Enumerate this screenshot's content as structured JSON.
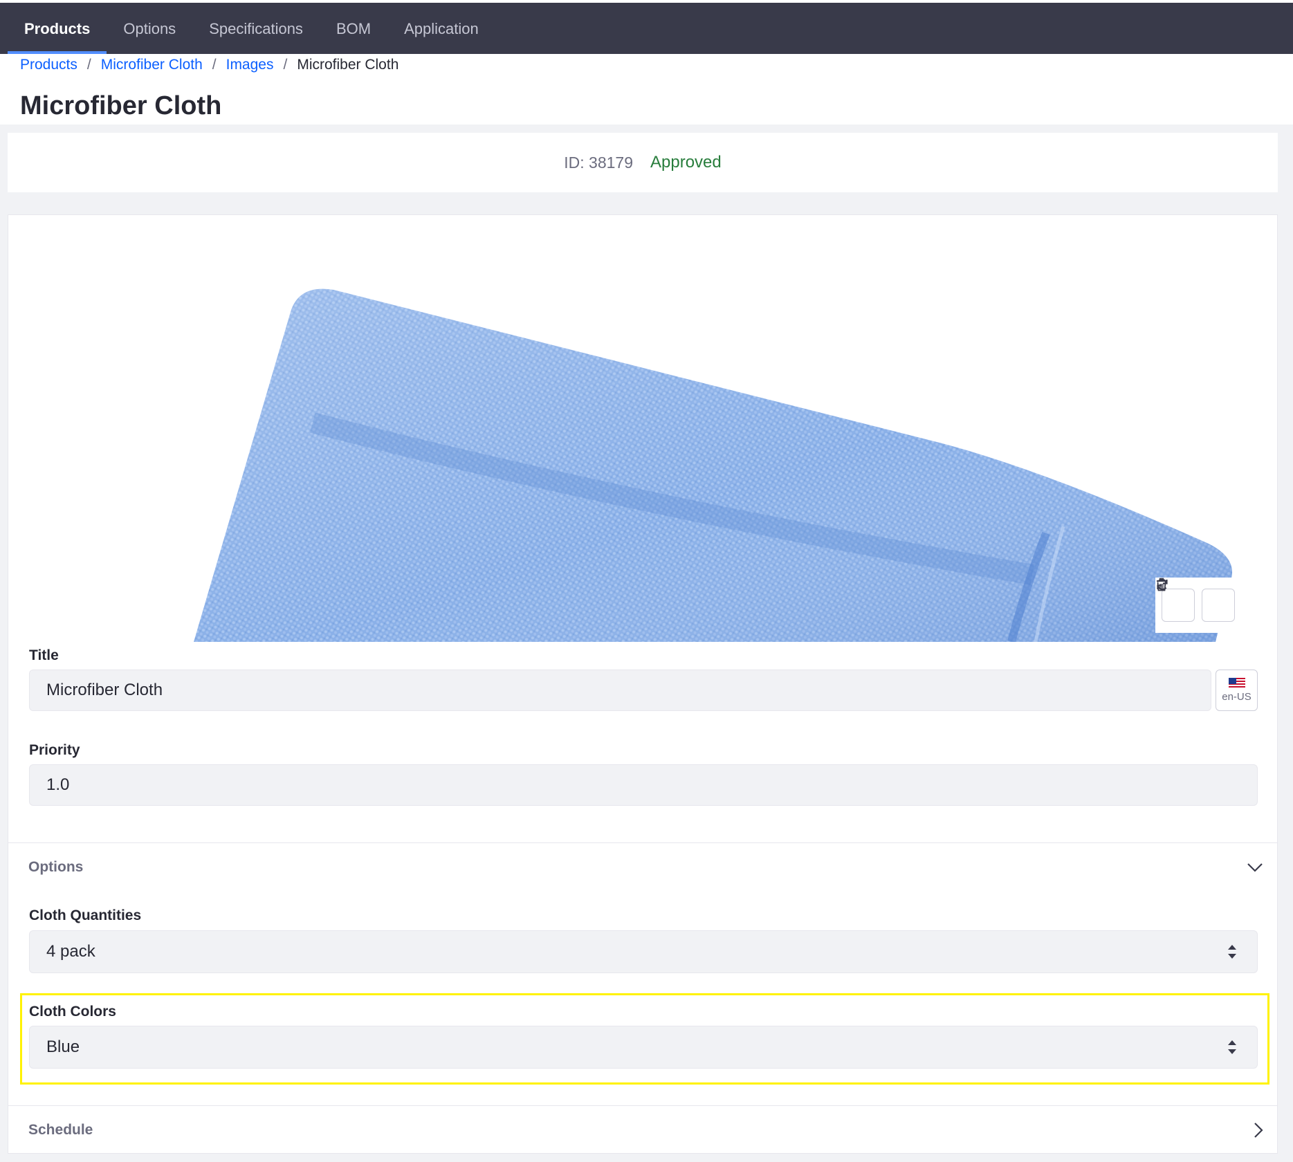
{
  "nav": {
    "tabs": [
      {
        "label": "Products"
      },
      {
        "label": "Options"
      },
      {
        "label": "Specifications"
      },
      {
        "label": "BOM"
      },
      {
        "label": "Application"
      }
    ],
    "active_tab": "Products"
  },
  "breadcrumb": {
    "items": [
      {
        "label": "Products"
      },
      {
        "label": "Microfiber Cloth"
      },
      {
        "label": "Images"
      }
    ],
    "current": "Microfiber Cloth",
    "separator": "/"
  },
  "page": {
    "title": "Microfiber Cloth"
  },
  "status": {
    "id": "ID: 38179",
    "workflow_status": "Approved"
  },
  "image": {
    "subject": "blue microfiber cloth",
    "actions": [
      "refresh-icon",
      "trash-icon"
    ]
  },
  "form": {
    "title_label": "Title",
    "title_value": "Microfiber Cloth",
    "language": "en-US",
    "priority_label": "Priority",
    "priority_value": "1.0"
  },
  "options_section": {
    "title": "Options",
    "cloth_quantities_label": "Cloth Quantities",
    "cloth_quantities_value": "4 pack",
    "cloth_colors_label": "Cloth Colors",
    "cloth_colors_value": "Blue"
  },
  "schedule_section": {
    "title": "Schedule"
  },
  "colors": {
    "navbar": "#393a4a",
    "link": "#0b5fff",
    "approved": "#287d3c",
    "highlight": "#fff200"
  }
}
